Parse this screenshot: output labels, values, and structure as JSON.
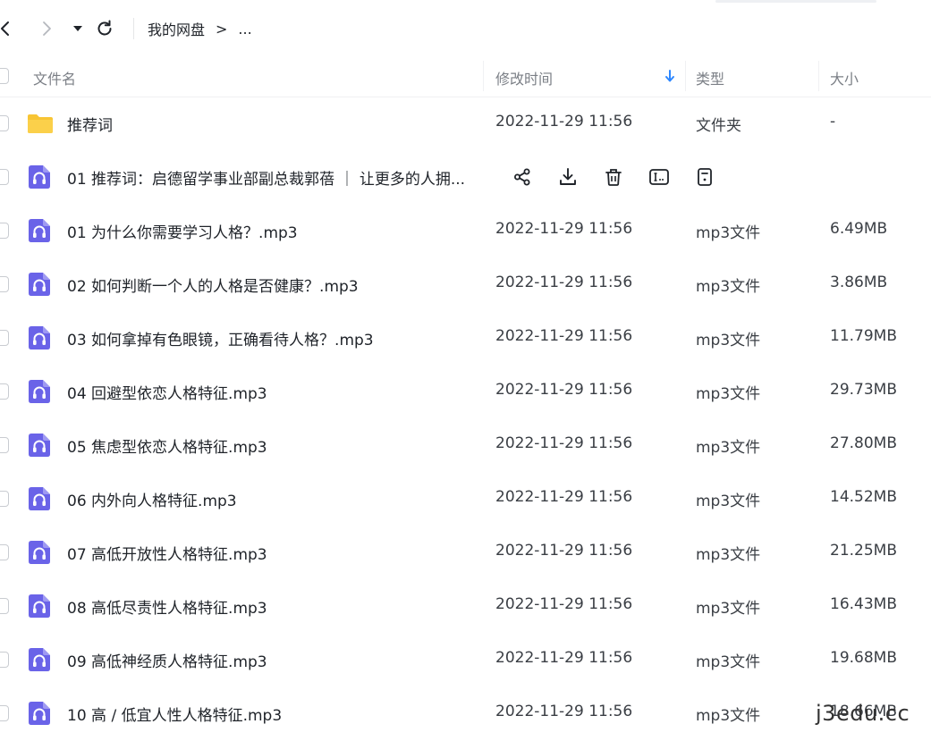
{
  "nav": {
    "breadcrumb_root": "我的网盘",
    "breadcrumb_sep": ">",
    "breadcrumb_more": "..."
  },
  "columns": {
    "name": "文件名",
    "modified": "修改时间",
    "type": "类型",
    "size": "大小"
  },
  "colors": {
    "folder": "#f8c534",
    "audio_icon": "#6a63e8",
    "accent": "#2f88ff"
  },
  "files": [
    {
      "name": "推荐词",
      "date": "2022-11-29 11:56",
      "type": "文件夹",
      "size": "-",
      "icon": "folder-icon"
    },
    {
      "name": "01 推荐词：启德留学事业部副总裁郭蓓 ｜ 让更多的人拥...",
      "date": "",
      "type": "",
      "size": "",
      "icon": "audio-file-icon",
      "hovered": true
    },
    {
      "name": "01 为什么你需要学习人格？.mp3",
      "date": "2022-11-29 11:56",
      "type": "mp3文件",
      "size": "6.49MB",
      "icon": "audio-file-icon"
    },
    {
      "name": "02 如何判断一个人的人格是否健康？.mp3",
      "date": "2022-11-29 11:56",
      "type": "mp3文件",
      "size": "3.86MB",
      "icon": "audio-file-icon"
    },
    {
      "name": "03 如何拿掉有色眼镜，正确看待人格？.mp3",
      "date": "2022-11-29 11:56",
      "type": "mp3文件",
      "size": "11.79MB",
      "icon": "audio-file-icon"
    },
    {
      "name": "04 回避型依恋人格特征.mp3",
      "date": "2022-11-29 11:56",
      "type": "mp3文件",
      "size": "29.73MB",
      "icon": "audio-file-icon"
    },
    {
      "name": "05 焦虑型依恋人格特征.mp3",
      "date": "2022-11-29 11:56",
      "type": "mp3文件",
      "size": "27.80MB",
      "icon": "audio-file-icon"
    },
    {
      "name": "06 内外向人格特征.mp3",
      "date": "2022-11-29 11:56",
      "type": "mp3文件",
      "size": "14.52MB",
      "icon": "audio-file-icon"
    },
    {
      "name": "07 高低开放性人格特征.mp3",
      "date": "2022-11-29 11:56",
      "type": "mp3文件",
      "size": "21.25MB",
      "icon": "audio-file-icon"
    },
    {
      "name": "08 高低尽责性人格特征.mp3",
      "date": "2022-11-29 11:56",
      "type": "mp3文件",
      "size": "16.43MB",
      "icon": "audio-file-icon"
    },
    {
      "name": "09 高低神经质人格特征.mp3",
      "date": "2022-11-29 11:56",
      "type": "mp3文件",
      "size": "19.68MB",
      "icon": "audio-file-icon"
    },
    {
      "name": "10 高 / 低宜人性人格特征.mp3",
      "date": "2022-11-29 11:56",
      "type": "mp3文件",
      "size": "18.66MB",
      "icon": "audio-file-icon"
    }
  ],
  "row_actions": [
    "share-icon",
    "download-icon",
    "delete-icon",
    "rename-icon",
    "more-icon"
  ],
  "watermark": "j3edu.cc"
}
